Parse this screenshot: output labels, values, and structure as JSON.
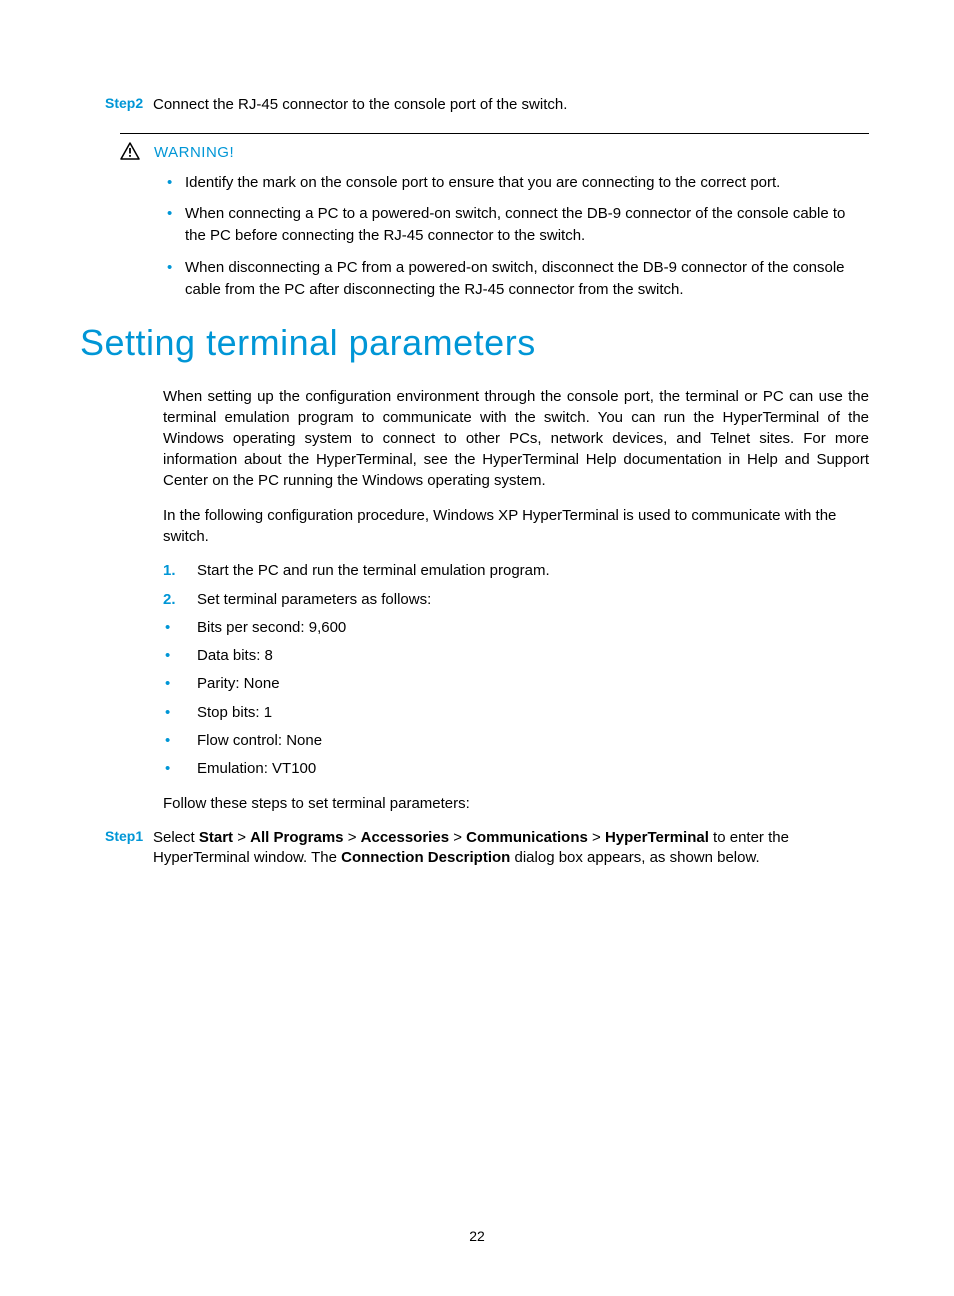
{
  "step2": {
    "label": "Step2",
    "text": "Connect the RJ-45 connector to the console port of the switch."
  },
  "warning": {
    "title": "WARNING!",
    "items": [
      "Identify the mark on the console port to ensure that you are connecting to the correct port.",
      "When connecting a PC to a powered-on switch, connect the DB-9 connector of the console cable to the PC before connecting the RJ-45 connector to the switch.",
      "When disconnecting a PC from a powered-on switch, disconnect the DB-9 connector of the console cable from the PC after disconnecting the RJ-45 connector from the switch."
    ]
  },
  "section": {
    "heading": "Setting terminal parameters",
    "para1": "When setting up the configuration environment through the console port, the terminal or PC can use the terminal emulation program to communicate with the switch. You can run the HyperTerminal of the Windows operating system to connect to other PCs, network devices, and Telnet sites. For more information about the HyperTerminal, see the HyperTerminal Help documentation in Help and Support Center on the PC running the Windows operating system.",
    "para2": "In the following configuration procedure, Windows XP HyperTerminal is used to communicate with the switch.",
    "list": {
      "n1": "1.",
      "t1": "Start the PC and run the terminal emulation program.",
      "n2": "2.",
      "t2": "Set terminal parameters as follows:",
      "b1": "Bits per second: 9,600",
      "b2": "Data bits: 8",
      "b3": "Parity: None",
      "b4": "Stop bits: 1",
      "b5": "Flow control: None",
      "b6": "Emulation: VT100"
    },
    "follow": "Follow these steps to set terminal parameters:"
  },
  "step1": {
    "label": "Step1",
    "pre": "Select ",
    "path1": "Start",
    "sep": " > ",
    "path2": "All Programs",
    "path3": "Accessories",
    "path4": "Communications",
    "path5": "HyperTerminal",
    "mid": " to enter the HyperTerminal window. The ",
    "bold2": "Connection Description",
    "post": " dialog box appears, as shown below."
  },
  "pageNumber": "22"
}
